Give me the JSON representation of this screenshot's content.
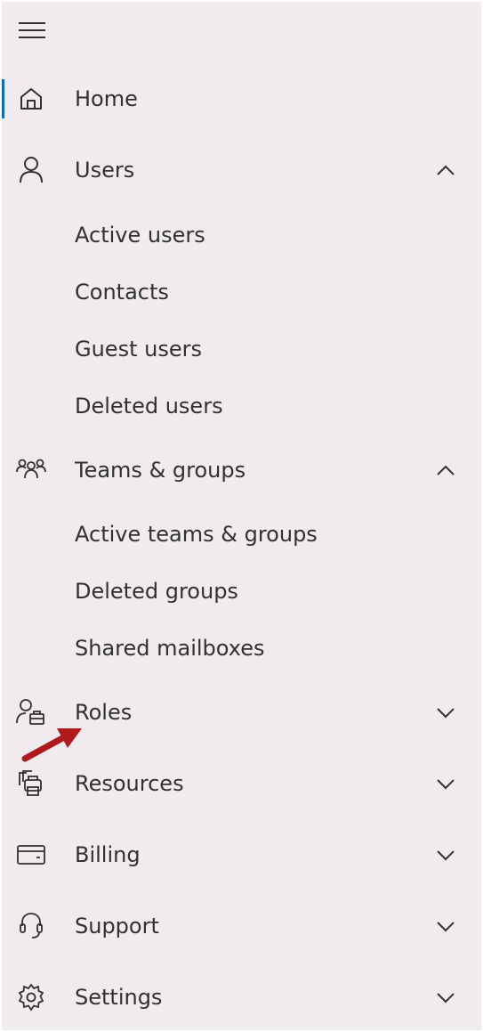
{
  "nav": {
    "home": "Home",
    "users": {
      "label": "Users",
      "children": [
        "Active users",
        "Contacts",
        "Guest users",
        "Deleted users"
      ]
    },
    "teams": {
      "label": "Teams & groups",
      "children": [
        "Active teams & groups",
        "Deleted groups",
        "Shared mailboxes"
      ]
    },
    "roles": "Roles",
    "resources": "Resources",
    "billing": "Billing",
    "support": "Support",
    "settings": "Settings"
  },
  "colors": {
    "panel_bg": "#efebef",
    "active_indicator": "#0f6cbd",
    "annotation_arrow": "#b01a1a",
    "text": "#323130"
  },
  "icons": {
    "menu": "hamburger-icon",
    "home": "home-icon",
    "users": "person-icon",
    "teams": "people-group-icon",
    "roles": "person-badge-icon",
    "resources": "printer-icon",
    "billing": "credit-card-icon",
    "support": "headset-icon",
    "settings": "gear-icon"
  }
}
